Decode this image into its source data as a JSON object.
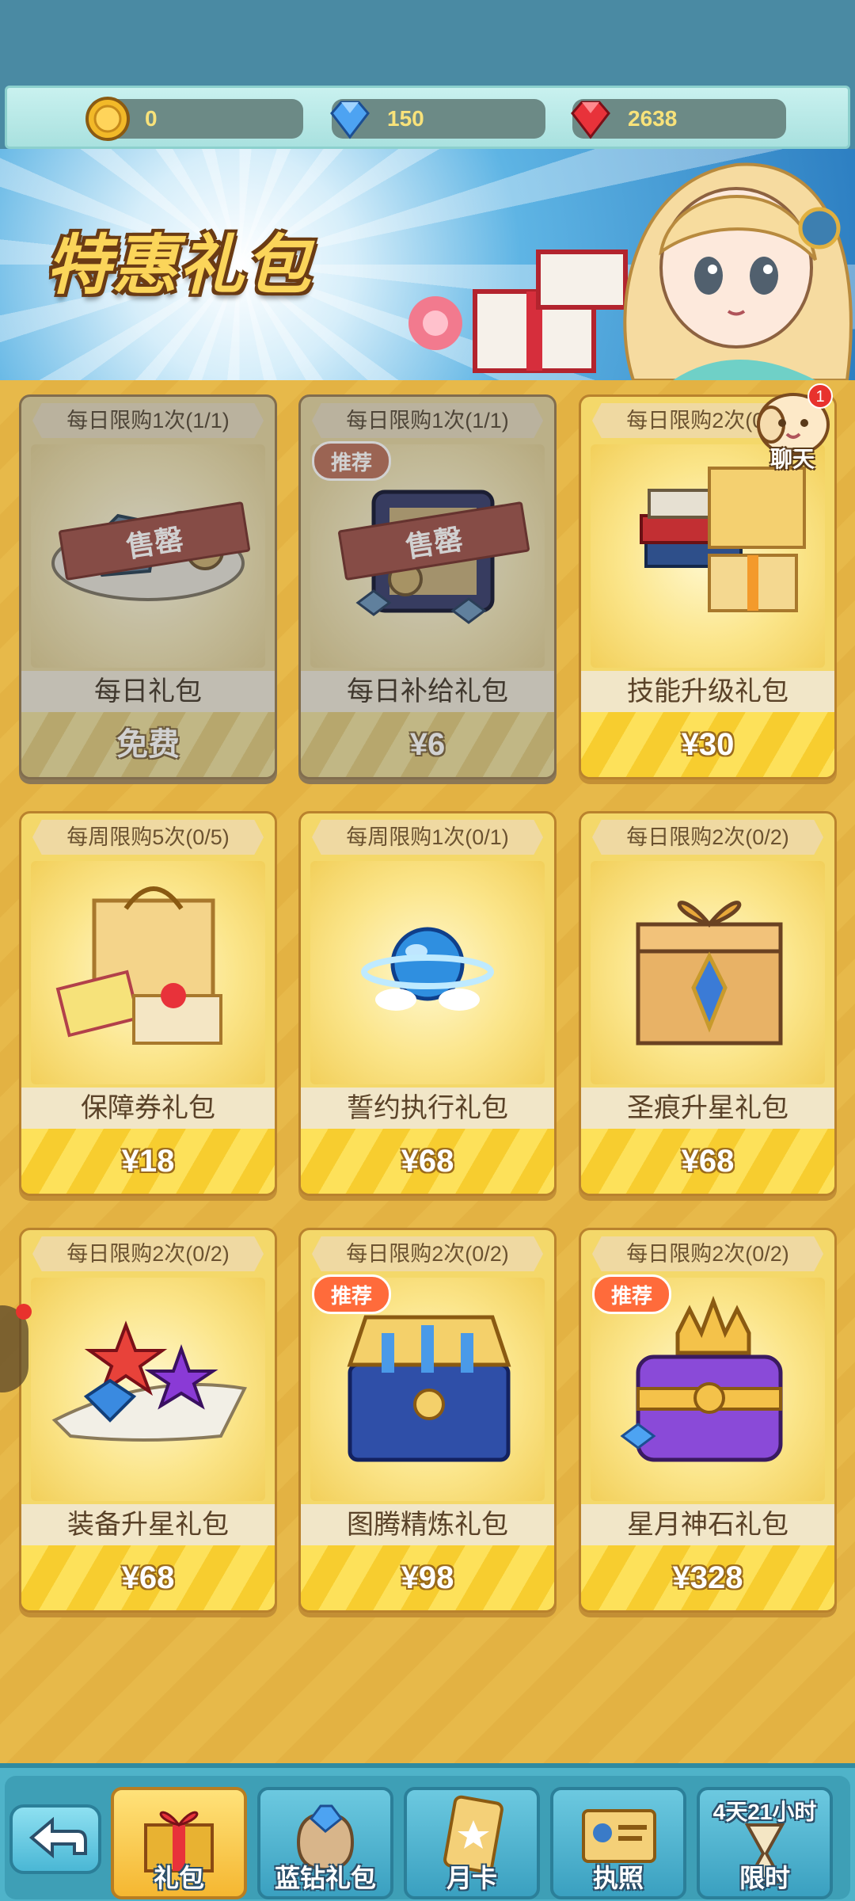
{
  "currency": [
    {
      "icon": "gold-coin-icon",
      "value": "0"
    },
    {
      "icon": "blue-diamond-icon",
      "value": "150"
    },
    {
      "icon": "red-gem-icon",
      "value": "2638"
    }
  ],
  "banner": {
    "title": "特惠礼包"
  },
  "chat": {
    "label": "聊天",
    "badge": "1"
  },
  "packs": [
    {
      "limit": "每日限购1次(1/1)",
      "name": "每日礼包",
      "price": "免费",
      "sold_out": true,
      "sold_label": "售罄",
      "recommended": false,
      "icon": "gem-plate-icon"
    },
    {
      "limit": "每日限购1次(1/1)",
      "name": "每日补给礼包",
      "price": "¥6",
      "sold_out": true,
      "sold_label": "售罄",
      "recommended": true,
      "icon": "supply-chest-icon"
    },
    {
      "limit": "每日限购2次(0/2)",
      "name": "技能升级礼包",
      "price": "¥30",
      "sold_out": false,
      "recommended": false,
      "icon": "books-icon"
    },
    {
      "limit": "每周限购5次(0/5)",
      "name": "保障券礼包",
      "price": "¥18",
      "sold_out": false,
      "recommended": false,
      "icon": "ticket-bag-icon"
    },
    {
      "limit": "每周限购1次(0/1)",
      "name": "誓约执行礼包",
      "price": "¥68",
      "sold_out": false,
      "recommended": false,
      "icon": "blue-orb-icon"
    },
    {
      "limit": "每日限购2次(0/2)",
      "name": "圣痕升星礼包",
      "price": "¥68",
      "sold_out": false,
      "recommended": false,
      "icon": "gift-box-icon"
    },
    {
      "limit": "每日限购2次(0/2)",
      "name": "装备升星礼包",
      "price": "¥68",
      "sold_out": false,
      "recommended": false,
      "icon": "stars-gems-icon"
    },
    {
      "limit": "每日限购2次(0/2)",
      "name": "图腾精炼礼包",
      "price": "¥98",
      "sold_out": false,
      "recommended": true,
      "icon": "totem-chest-icon"
    },
    {
      "limit": "每日限购2次(0/2)",
      "name": "星月神石礼包",
      "price": "¥328",
      "sold_out": false,
      "recommended": true,
      "icon": "crown-chest-icon"
    }
  ],
  "labels": {
    "recommended": "推荐"
  },
  "nav": {
    "tabs": [
      {
        "label": "礼包",
        "active": true
      },
      {
        "label": "蓝钻礼包",
        "active": false
      },
      {
        "label": "月卡",
        "active": false
      },
      {
        "label": "执照",
        "active": false
      },
      {
        "label": "限时",
        "active": false,
        "timer": "4天21小时"
      }
    ]
  }
}
